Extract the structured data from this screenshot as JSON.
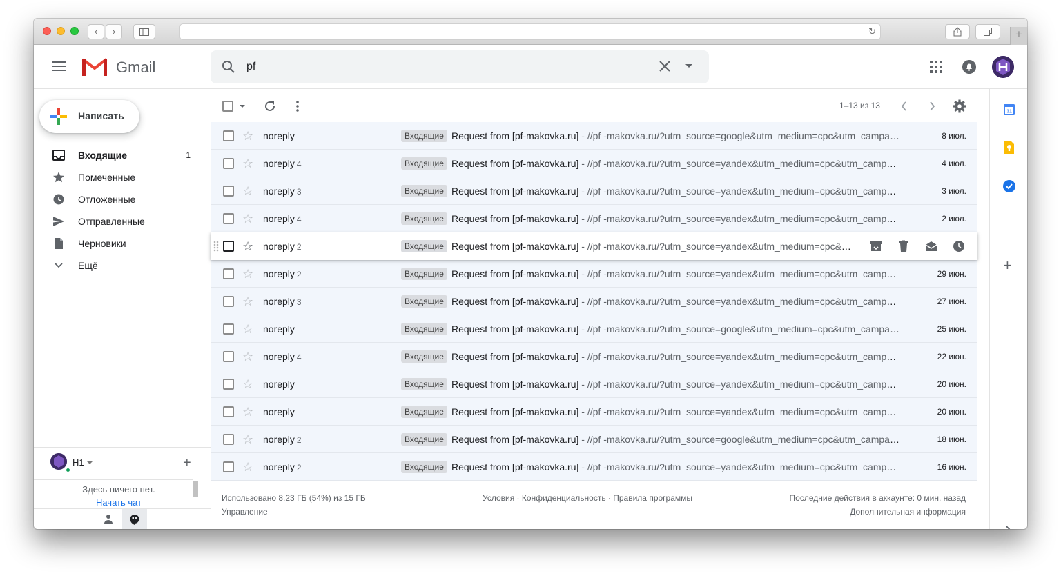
{
  "browser": {
    "url": ""
  },
  "header": {
    "app_name": "Gmail",
    "search_value": "pf"
  },
  "compose": {
    "label": "Написать"
  },
  "sidebar": {
    "items": [
      {
        "label": "Входящие",
        "count": "1",
        "icon": "inbox-icon"
      },
      {
        "label": "Помеченные",
        "count": "",
        "icon": "star-icon"
      },
      {
        "label": "Отложенные",
        "count": "",
        "icon": "clock-icon"
      },
      {
        "label": "Отправленные",
        "count": "",
        "icon": "send-icon"
      },
      {
        "label": "Черновики",
        "count": "",
        "icon": "draft-icon"
      },
      {
        "label": "Ещё",
        "count": "",
        "icon": "chevron-down-icon"
      }
    ]
  },
  "hangouts": {
    "user": "H1",
    "empty_text": "Здесь ничего нет.",
    "start_chat": "Начать чат"
  },
  "toolbar": {
    "pager": "1–13 из 13"
  },
  "emails": [
    {
      "sender": "noreply",
      "count": "",
      "label": "Входящие",
      "subject": "Request from [pf-makovka.ru]",
      "preview": " - //pf -makovka.ru/?utm_source=google&utm_medium=cpc&utm_campaign=",
      "date": "8 июл."
    },
    {
      "sender": "noreply",
      "count": "4",
      "label": "Входящие",
      "subject": "Request from [pf-makovka.ru]",
      "preview": " - //pf -makovka.ru/?utm_source=yandex&utm_medium=cpc&utm_campaign=",
      "date": "4 июл."
    },
    {
      "sender": "noreply",
      "count": "3",
      "label": "Входящие",
      "subject": "Request from [pf-makovka.ru]",
      "preview": " - //pf -makovka.ru/?utm_source=yandex&utm_medium=cpc&utm_campaign=",
      "date": "3 июл."
    },
    {
      "sender": "noreply",
      "count": "4",
      "label": "Входящие",
      "subject": "Request from [pf-makovka.ru]",
      "preview": " - //pf -makovka.ru/?utm_source=yandex&utm_medium=cpc&utm_campaign=",
      "date": "2 июл."
    },
    {
      "sender": "noreply",
      "count": "2",
      "label": "Входящие",
      "subject": "Request from [pf-makovka.ru]",
      "preview": " - //pf -makovka.ru/?utm_source=yandex&utm_medium=cpc&utm_campaign=",
      "date": ""
    },
    {
      "sender": "noreply",
      "count": "2",
      "label": "Входящие",
      "subject": "Request from [pf-makovka.ru]",
      "preview": " - //pf -makovka.ru/?utm_source=yandex&utm_medium=cpc&utm_campaign=",
      "date": "29 июн."
    },
    {
      "sender": "noreply",
      "count": "3",
      "label": "Входящие",
      "subject": "Request from [pf-makovka.ru]",
      "preview": " - //pf -makovka.ru/?utm_source=yandex&utm_medium=cpc&utm_campaign=",
      "date": "27 июн."
    },
    {
      "sender": "noreply",
      "count": "",
      "label": "Входящие",
      "subject": "Request from [pf-makovka.ru]",
      "preview": " - //pf -makovka.ru/?utm_source=google&utm_medium=cpc&utm_campaign=",
      "date": "25 июн."
    },
    {
      "sender": "noreply",
      "count": "4",
      "label": "Входящие",
      "subject": "Request from [pf-makovka.ru]",
      "preview": " - //pf -makovka.ru/?utm_source=yandex&utm_medium=cpc&utm_campaign=",
      "date": "22 июн."
    },
    {
      "sender": "noreply",
      "count": "",
      "label": "Входящие",
      "subject": "Request from [pf-makovka.ru]",
      "preview": " - //pf -makovka.ru/?utm_source=yandex&utm_medium=cpc&utm_campaign=",
      "date": "20 июн."
    },
    {
      "sender": "noreply",
      "count": "",
      "label": "Входящие",
      "subject": "Request from [pf-makovka.ru]",
      "preview": " - //pf -makovka.ru/?utm_source=yandex&utm_medium=cpc&utm_campaign=",
      "date": "20 июн."
    },
    {
      "sender": "noreply",
      "count": "2",
      "label": "Входящие",
      "subject": "Request from [pf-makovka.ru]",
      "preview": " - //pf -makovka.ru/?utm_source=google&utm_medium=cpc&utm_campaign=",
      "date": "18 июн."
    },
    {
      "sender": "noreply",
      "count": "2",
      "label": "Входящие",
      "subject": "Request from [pf-makovka.ru]",
      "preview": " - //pf -makovka.ru/?utm_source=yandex&utm_medium=cpc&utm_campaign=",
      "date": "16 июн."
    }
  ],
  "hover_row": 4,
  "footer": {
    "usage": "Использовано 8,23 ГБ (54%) из 15 ГБ",
    "manage": "Управление",
    "links": "Условия · Конфиденциальность · Правила программы",
    "activity": "Последние действия в аккаунте: 0 мин. назад",
    "details": "Дополнительная информация"
  },
  "colors": {
    "row_bg": "#f2f6fc",
    "label_bg": "#dadce0",
    "link": "#1a73e8"
  }
}
